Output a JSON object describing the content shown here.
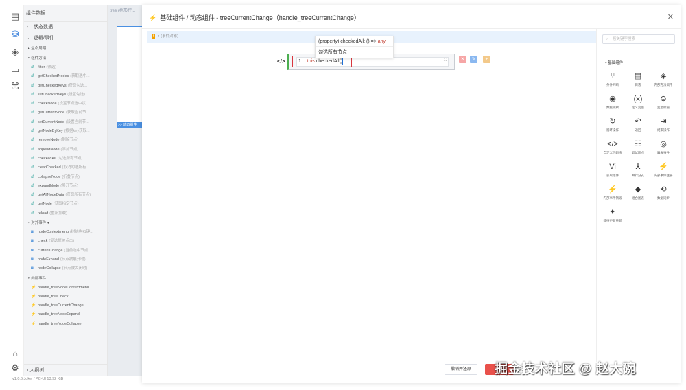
{
  "sidebar": {
    "header": "组件数据",
    "sections": {
      "state": "状态数据",
      "logic": "逻辑/事件",
      "lifecycle": "生命周期",
      "methods": "组件方法",
      "external": "对外事件",
      "internal": "内部事件",
      "outline": "大纲树"
    },
    "methods": [
      {
        "name": "filter",
        "note": "(筛选)"
      },
      {
        "name": "getCheckedNodes",
        "note": "(获取选中..."
      },
      {
        "name": "getCheckedKeys",
        "note": "(获取勾选..."
      },
      {
        "name": "setCheckedKeys",
        "note": "(设置勾选)"
      },
      {
        "name": "checkNode",
        "note": "(设置节点选中状..."
      },
      {
        "name": "getCurrentNode",
        "note": "(获取当前节..."
      },
      {
        "name": "setCurrentNode",
        "note": "(设置当前节..."
      },
      {
        "name": "getNodeByKey",
        "note": "(根据key获取..."
      },
      {
        "name": "removeNode",
        "note": "(删除节点)"
      },
      {
        "name": "appendNode",
        "note": "(添加节点)"
      },
      {
        "name": "checkedAll",
        "note": "(勾选所有节点)"
      },
      {
        "name": "clearChecked",
        "note": "(取消勾选所有..."
      },
      {
        "name": "collapseNode",
        "note": "(折叠节点)"
      },
      {
        "name": "expandNode",
        "note": "(展开节点)"
      },
      {
        "name": "getAllNodeData",
        "note": "(获取所有节点)"
      },
      {
        "name": "getNode",
        "note": "(获取指定节点)"
      },
      {
        "name": "reload",
        "note": "(重新加载)"
      }
    ],
    "external_events": [
      {
        "name": "nodeContextmenu",
        "note": "(树结构右键..."
      },
      {
        "name": "check",
        "note": "(复选框被点击)"
      },
      {
        "name": "currentChange",
        "note": "(当前选中节点..."
      },
      {
        "name": "nodeExpand",
        "note": "(节点被展开时)"
      },
      {
        "name": "nodeCollapse",
        "note": "(节点被关闭时)"
      }
    ],
    "internal_events": [
      "handle_treeNodeContextmenu",
      "handle_treeCheck",
      "handle_treeCurrentChange",
      "handle_treeNodeExpand",
      "handle_treeNodeCollapse"
    ],
    "version": "v1.0.6  Jokei / PC-UI  13.92 KiB"
  },
  "background": {
    "tab": "tree  (树形控...",
    "selected_label": ">> 动态组件"
  },
  "dialog": {
    "title": "基础组件 / 动态组件 - treeCurrentChange（handle_treeCurrentChange）",
    "event_bar": "(事件对象)",
    "event_tag": "f",
    "code": {
      "line_no": "1",
      "this_kw": "this",
      "rest": ".checkedAll()"
    },
    "tooltip": {
      "signature_pre": "(property) checkedAll: () => ",
      "signature_type": "any",
      "desc": "勾选所有节点"
    },
    "cancel_button": "撤销并还原",
    "confirm_button": "确定"
  },
  "panel": {
    "search_placeholder": "按关键字搜索",
    "group_title": "基础组件",
    "components": [
      {
        "label": "条件判断",
        "icon": "branch-icon",
        "glyph": "⑂"
      },
      {
        "label": "日志",
        "icon": "log-icon",
        "glyph": "▤"
      },
      {
        "label": "内部方法调用",
        "icon": "method-icon",
        "glyph": "◈"
      },
      {
        "label": "数据观察",
        "icon": "watch-icon",
        "glyph": "◉"
      },
      {
        "label": "定义变量",
        "icon": "variable-icon",
        "glyph": "(x)"
      },
      {
        "label": "变量赋值",
        "icon": "assign-icon",
        "glyph": "⊜"
      },
      {
        "label": "循环操作",
        "icon": "loop-icon",
        "glyph": "↻"
      },
      {
        "label": "返回",
        "icon": "return-icon",
        "glyph": "↶"
      },
      {
        "label": "结束操作",
        "icon": "exit-icon",
        "glyph": "⇥"
      },
      {
        "label": "自定义代码块",
        "icon": "code-icon",
        "glyph": "</>"
      },
      {
        "label": "调试断点",
        "icon": "debug-icon",
        "glyph": "☷"
      },
      {
        "label": "触发事件",
        "icon": "trigger-icon",
        "glyph": "◎"
      },
      {
        "label": "获取组件",
        "icon": "component-icon",
        "glyph": "Vi"
      },
      {
        "label": "并行分支",
        "icon": "parallel-icon",
        "glyph": "⅄"
      },
      {
        "label": "内部事件注册",
        "icon": "event-register-icon",
        "glyph": "⚡"
      },
      {
        "label": "内部事件销毁",
        "icon": "event-destroy-icon",
        "glyph": "⚡"
      },
      {
        "label": "组合图表",
        "icon": "cube-icon",
        "glyph": "◆"
      },
      {
        "label": "数据同步",
        "icon": "sync-icon",
        "glyph": "⟲"
      },
      {
        "label": "等待更新重新",
        "icon": "refresh-icon",
        "glyph": "✦"
      }
    ]
  },
  "watermark": "掘金技术社区 @ 赵大碗",
  "colors": {
    "accent": "#1f6fd6",
    "event_bar": "#e8f2fd",
    "code_border": "#4caf50",
    "highlight_box": "#d9363e",
    "confirm_button": "#e9514b"
  }
}
